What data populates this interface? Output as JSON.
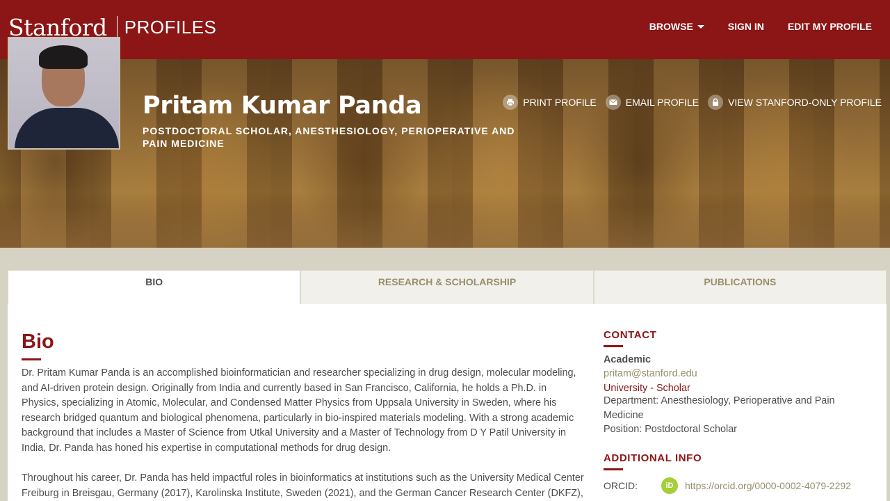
{
  "header": {
    "brand_name": "Stanford",
    "brand_section": "PROFILES",
    "nav": {
      "browse": "BROWSE",
      "sign_in": "SIGN IN",
      "edit_profile": "EDIT MY PROFILE"
    }
  },
  "profile": {
    "name": "Pritam Kumar Panda",
    "title": "POSTDOCTORAL SCHOLAR, ANESTHESIOLOGY, PERIOPERATIVE AND PAIN MEDICINE",
    "actions": {
      "print": "PRINT PROFILE",
      "email": "EMAIL PROFILE",
      "stanford_only": "VIEW STANFORD-ONLY PROFILE"
    }
  },
  "tabs": [
    "BIO",
    "RESEARCH & SCHOLARSHIP",
    "PUBLICATIONS"
  ],
  "bio": {
    "heading": "Bio",
    "paragraphs": [
      "Dr. Pritam Kumar Panda is an accomplished bioinformatician and researcher specializing in drug design, molecular modeling, and AI-driven protein design. Originally from India and currently based in San Francisco, California, he holds a Ph.D. in Physics, specializing in Atomic, Molecular, and Condensed Matter Physics from Uppsala University in Sweden, where his research bridged quantum and biological phenomena, particularly in bio-inspired materials modeling. With a strong academic background that includes a Master of Science from Utkal University and a Master of Technology from D Y Patil University in India, Dr. Panda has honed his expertise in computational methods for drug design.",
      "Throughout his career, Dr. Panda has held impactful roles in bioinformatics at institutions such as the University Medical Center Freiburg in Breisgau, Germany (2017), Karolinska Institute, Sweden (2021), and the German Cancer Research Center (DKFZ),"
    ]
  },
  "contact": {
    "heading": "CONTACT",
    "type": "Academic",
    "email": "pritam@stanford.edu",
    "role": "University - Scholar",
    "department": "Department: Anesthesiology, Perioperative and Pain Medicine",
    "position": "Position: Postdoctoral Scholar"
  },
  "additional_info": {
    "heading": "ADDITIONAL INFO",
    "orcid_label": "ORCID:",
    "orcid_icon_text": "iD",
    "orcid_url": "https://orcid.org/0000-0002-4079-2292"
  },
  "icons": {
    "print": "print-icon",
    "email": "envelope-icon",
    "lock": "lock-icon",
    "orcid": "orcid-icon",
    "caret": "caret-down-icon"
  },
  "colors": {
    "cardinal": "#8c1515",
    "sandstone": "#d6d2c4",
    "link": "#988e6b",
    "orcid": "#a6ce39"
  }
}
